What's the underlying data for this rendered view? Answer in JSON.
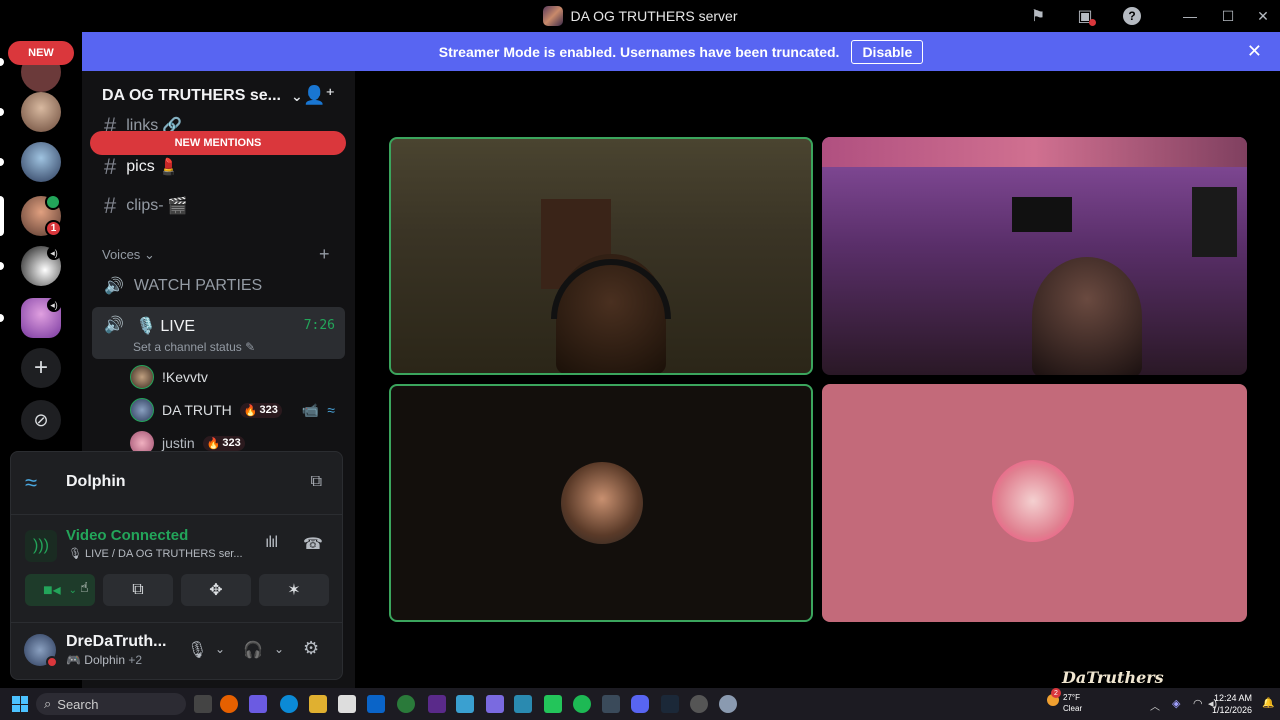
{
  "window": {
    "title": "DA OG TRUTHERS server"
  },
  "rail": {
    "new_badge": "NEW",
    "notif_count": "1"
  },
  "banner": {
    "message": "Streamer Mode is enabled. Usernames have been truncated.",
    "disable_label": "Disable"
  },
  "sidebar": {
    "server_name": "DA OG TRUTHERS se...",
    "new_mentions": "NEW MENTIONS",
    "channels": [
      {
        "name": "links"
      },
      {
        "name": "pics"
      },
      {
        "name": "clips-"
      }
    ],
    "voice_category": "Voices",
    "watch_parties": "WATCH PARTIES",
    "live_channel": {
      "name": "LIVE",
      "time": "7:26",
      "status": "Set a channel status"
    },
    "voice_users": [
      {
        "name": "!Kevvtv",
        "boost": ""
      },
      {
        "name": "DA TRUTH",
        "boost": "323"
      },
      {
        "name": "justin",
        "boost": "323"
      }
    ]
  },
  "panel": {
    "activity": "Dolphin",
    "connection_status": "Video Connected",
    "connection_channel": "LIVE / DA OG TRUTHERS ser...",
    "user_name": "DreDaTruth...",
    "user_activity": "Dolphin",
    "user_activity_extra": "+2"
  },
  "taskbar": {
    "search_placeholder": "Search",
    "weather_temp": "27°F",
    "weather_desc": "Clear",
    "time": "12:24 AM",
    "date": "1/12/2026",
    "weather_badge": "2"
  },
  "watermark": "DaTruthers",
  "colors": {
    "blurple": "#5865f2",
    "red": "#da373c",
    "green": "#3ba55d",
    "sidebar_bg": "#121214"
  }
}
